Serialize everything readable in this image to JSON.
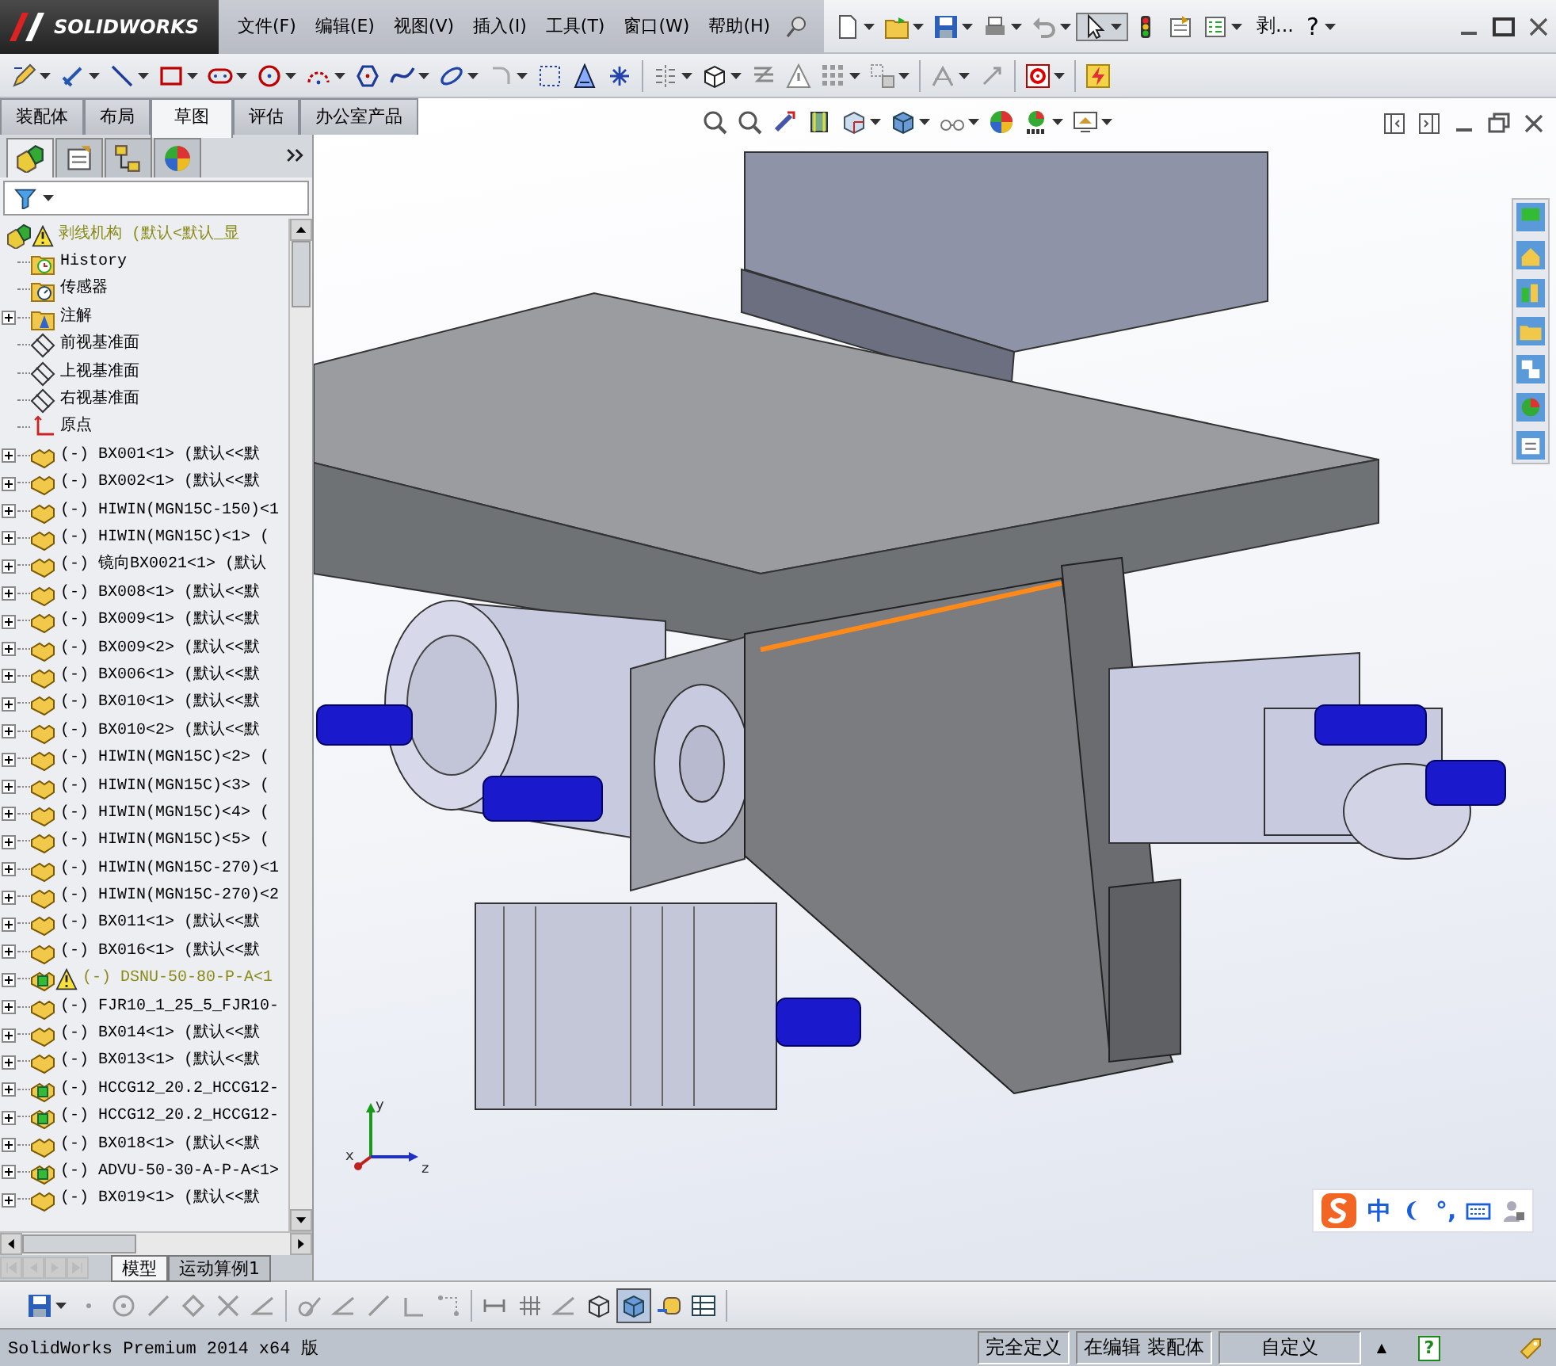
{
  "app": {
    "logo": "SOLIDWORKS",
    "menus": [
      "文件(F)",
      "编辑(E)",
      "视图(V)",
      "插入(I)",
      "工具(T)",
      "窗口(W)",
      "帮助(H)"
    ],
    "document_title": "剥...",
    "help": "?"
  },
  "command_tabs": [
    {
      "label": "装配体",
      "selected": false
    },
    {
      "label": "布局",
      "selected": false
    },
    {
      "label": "草图",
      "selected": true
    },
    {
      "label": "评估",
      "selected": false
    },
    {
      "label": "办公室产品",
      "selected": false
    }
  ],
  "tree": {
    "root": {
      "label": "剥线机构 (默认<默认_显",
      "warning": true,
      "children": [
        {
          "label": "History",
          "kind": "history",
          "expandable": false,
          "warning": false
        },
        {
          "label": "传感器",
          "kind": "sensor",
          "expandable": false,
          "warning": false
        },
        {
          "label": "注解",
          "kind": "annotation",
          "expandable": true,
          "warning": false
        },
        {
          "label": "前视基准面",
          "kind": "plane",
          "expandable": false,
          "warning": false
        },
        {
          "label": "上视基准面",
          "kind": "plane",
          "expandable": false,
          "warning": false
        },
        {
          "label": "右视基准面",
          "kind": "plane",
          "expandable": false,
          "warning": false
        },
        {
          "label": "原点",
          "kind": "origin",
          "expandable": false,
          "warning": false
        },
        {
          "label": "(-) BX001<1> (默认<<默",
          "kind": "part",
          "expandable": true,
          "warning": false
        },
        {
          "label": "(-) BX002<1> (默认<<默",
          "kind": "part",
          "expandable": true,
          "warning": false
        },
        {
          "label": "(-) HIWIN(MGN15C-150)<1",
          "kind": "part",
          "expandable": true,
          "warning": false
        },
        {
          "label": "(-) HIWIN(MGN15C)<1> (",
          "kind": "part",
          "expandable": true,
          "warning": false
        },
        {
          "label": "(-) 镜向BX0021<1> (默认",
          "kind": "part",
          "expandable": true,
          "warning": false
        },
        {
          "label": "(-) BX008<1> (默认<<默",
          "kind": "part",
          "expandable": true,
          "warning": false
        },
        {
          "label": "(-) BX009<1> (默认<<默",
          "kind": "part",
          "expandable": true,
          "warning": false
        },
        {
          "label": "(-) BX009<2> (默认<<默",
          "kind": "part",
          "expandable": true,
          "warning": false
        },
        {
          "label": "(-) BX006<1> (默认<<默",
          "kind": "part",
          "expandable": true,
          "warning": false
        },
        {
          "label": "(-) BX010<1> (默认<<默",
          "kind": "part",
          "expandable": true,
          "warning": false
        },
        {
          "label": "(-) BX010<2> (默认<<默",
          "kind": "part",
          "expandable": true,
          "warning": false
        },
        {
          "label": "(-) HIWIN(MGN15C)<2> (",
          "kind": "part",
          "expandable": true,
          "warning": false
        },
        {
          "label": "(-) HIWIN(MGN15C)<3> (",
          "kind": "part",
          "expandable": true,
          "warning": false
        },
        {
          "label": "(-) HIWIN(MGN15C)<4> (",
          "kind": "part",
          "expandable": true,
          "warning": false
        },
        {
          "label": "(-) HIWIN(MGN15C)<5> (",
          "kind": "part",
          "expandable": true,
          "warning": false
        },
        {
          "label": "(-) HIWIN(MGN15C-270)<1",
          "kind": "part",
          "expandable": true,
          "warning": false
        },
        {
          "label": "(-) HIWIN(MGN15C-270)<2",
          "kind": "part",
          "expandable": true,
          "warning": false
        },
        {
          "label": "(-) BX011<1> (默认<<默",
          "kind": "part",
          "expandable": true,
          "warning": false
        },
        {
          "label": "(-) BX016<1> (默认<<默",
          "kind": "part",
          "expandable": true,
          "warning": false
        },
        {
          "label": "(-) DSNU-50-80-P-A<1",
          "kind": "assembly",
          "expandable": true,
          "warning": true
        },
        {
          "label": "(-) FJR10_1_25_5_FJR10-",
          "kind": "part",
          "expandable": true,
          "warning": false
        },
        {
          "label": "(-) BX014<1> (默认<<默",
          "kind": "part",
          "expandable": true,
          "warning": false
        },
        {
          "label": "(-) BX013<1> (默认<<默",
          "kind": "part",
          "expandable": true,
          "warning": false
        },
        {
          "label": "(-) HCCG12_20.2_HCCG12-",
          "kind": "assembly",
          "expandable": true,
          "warning": false
        },
        {
          "label": "(-) HCCG12_20.2_HCCG12-",
          "kind": "assembly",
          "expandable": true,
          "warning": false
        },
        {
          "label": "(-) BX018<1> (默认<<默",
          "kind": "part",
          "expandable": true,
          "warning": false
        },
        {
          "label": "(-) ADVU-50-30-A-P-A<1>",
          "kind": "assembly",
          "expandable": true,
          "warning": false
        },
        {
          "label": "(-) BX019<1> (默认<<默",
          "kind": "part",
          "expandable": true,
          "warning": false
        }
      ]
    }
  },
  "viewport": {
    "triad_labels": [
      "y",
      "x",
      "z"
    ],
    "ime": {
      "mode": "中",
      "punctuation": "°,"
    }
  },
  "bottom_tabs": [
    {
      "label": "模型",
      "selected": true
    },
    {
      "label": "运动算例1",
      "selected": false
    }
  ],
  "status_bar": {
    "product": "SolidWorks Premium 2014 x64 版",
    "fields": [
      "完全定义",
      "在编辑 装配体",
      "自定义"
    ],
    "arrow": "▲",
    "help": "?"
  }
}
